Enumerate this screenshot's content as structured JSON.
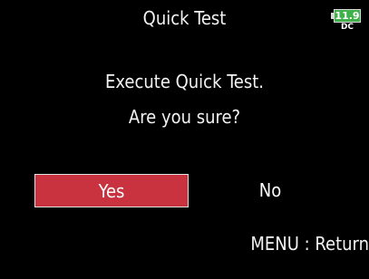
{
  "header": {
    "title": "Quick Test",
    "battery": {
      "value": "11.9",
      "source": "DC",
      "color": "#3fb04a"
    }
  },
  "dialog": {
    "message_line1": "Execute Quick Test.",
    "message_line2": "Are you sure?",
    "yes_label": "Yes",
    "no_label": "No",
    "selected": "yes",
    "selected_color": "#c8333f"
  },
  "footer": {
    "menu_hint": "MENU : Return"
  }
}
